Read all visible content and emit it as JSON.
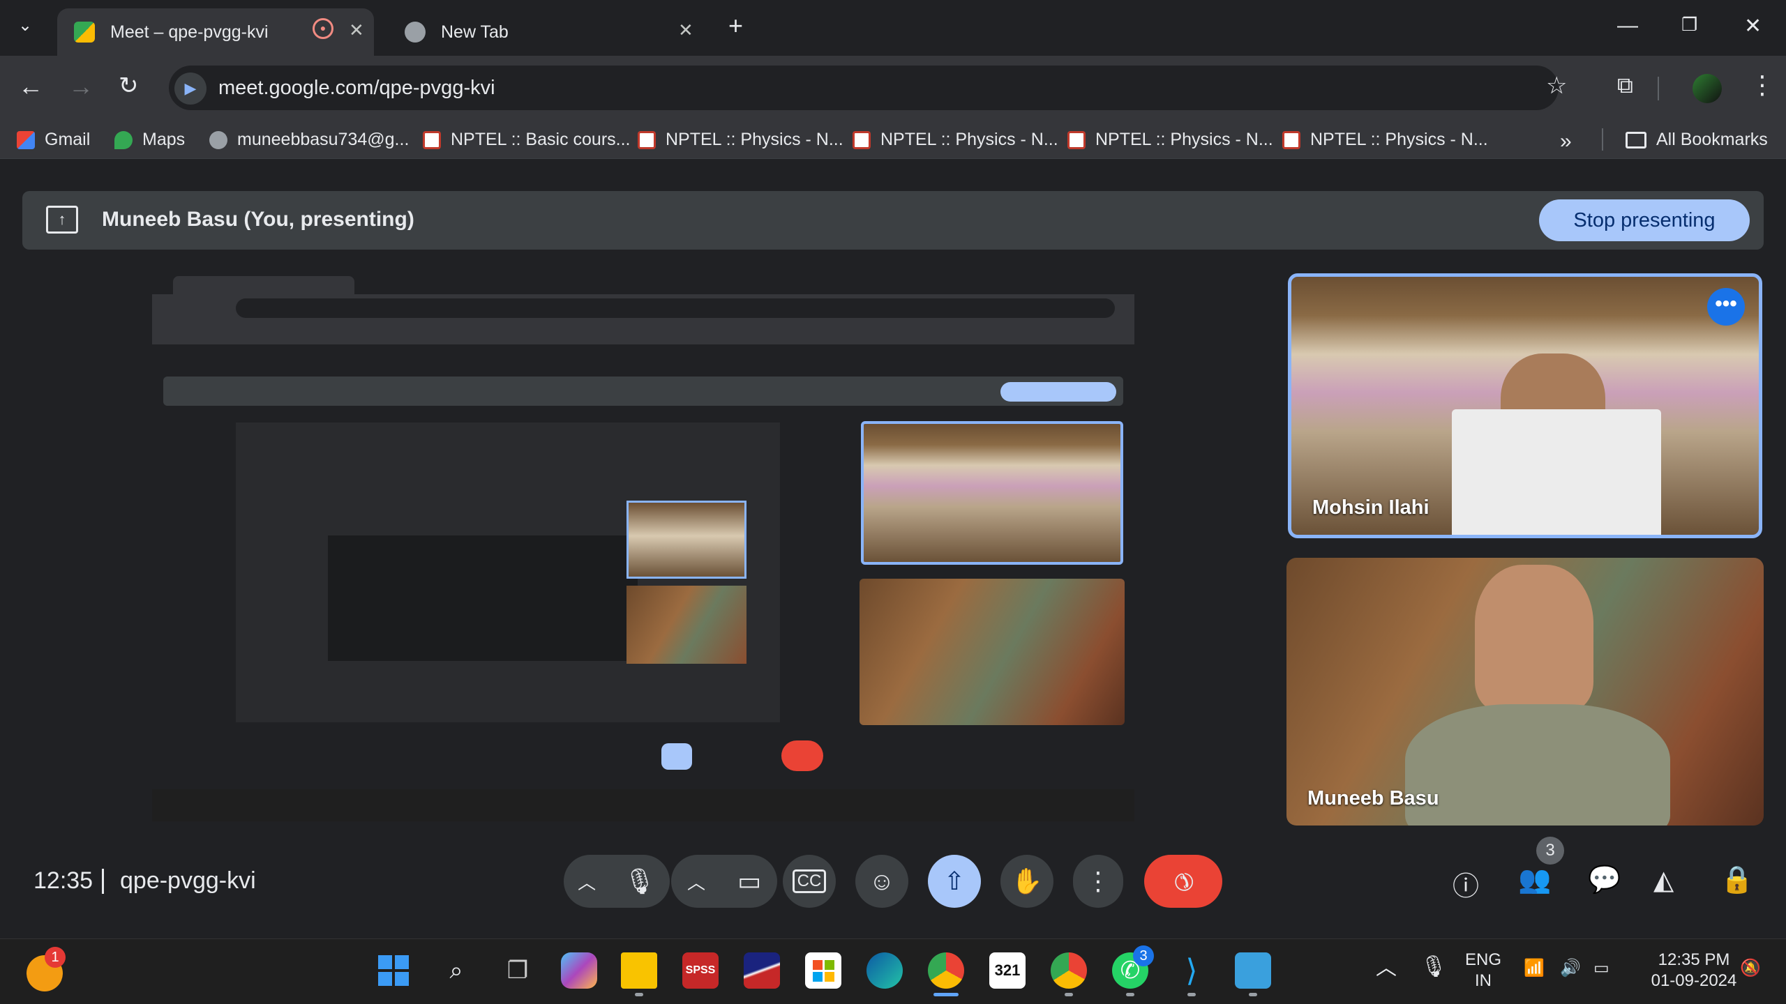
{
  "browser": {
    "tabs": [
      {
        "title": "Meet – qpe-pvgg-kvi",
        "active": true
      },
      {
        "title": "New Tab",
        "active": false
      }
    ],
    "url": "meet.google.com/qpe-pvgg-kvi",
    "bookmarks": [
      {
        "label": "Gmail",
        "icon": "gmail-icon"
      },
      {
        "label": "Maps",
        "icon": "maps-icon"
      },
      {
        "label": "muneebbasu734@g...",
        "icon": "globe-icon"
      },
      {
        "label": "NPTEL :: Basic cours...",
        "icon": "nptel-icon"
      },
      {
        "label": "NPTEL :: Physics - N...",
        "icon": "nptel-icon"
      },
      {
        "label": "NPTEL :: Physics - N...",
        "icon": "nptel-icon"
      },
      {
        "label": "NPTEL :: Physics - N...",
        "icon": "nptel-icon"
      },
      {
        "label": "NPTEL :: Physics - N...",
        "icon": "nptel-icon"
      }
    ],
    "all_bookmarks": "All Bookmarks"
  },
  "meet": {
    "presenting_label": "Muneeb Basu (You, presenting)",
    "stop_presenting": "Stop presenting",
    "participants": [
      {
        "name": "Mohsin Ilahi",
        "speaking": true
      },
      {
        "name": "Muneeb Basu",
        "speaking": false
      }
    ],
    "time": "12:35",
    "meeting_code": "qpe-pvgg-kvi",
    "people_count": "3"
  },
  "taskbar": {
    "notification_badge": "1",
    "whatsapp_badge": "3",
    "language": "ENG",
    "region": "IN",
    "time": "12:35 PM",
    "date": "01-09-2024"
  },
  "colors": {
    "accent": "#8ab4f8",
    "stop_button": "#a8c7fa",
    "end_call": "#ea4335",
    "present_active": "#a8c7fa"
  }
}
